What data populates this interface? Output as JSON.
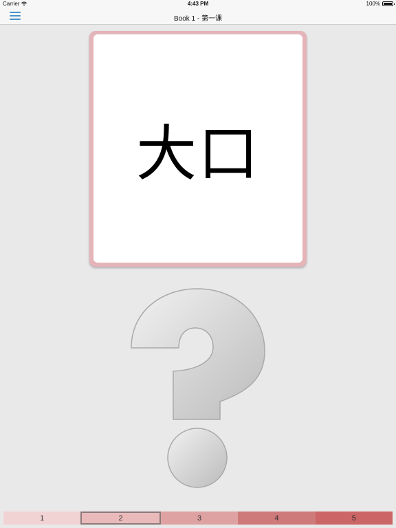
{
  "status_bar": {
    "carrier": "Carrier",
    "time": "4:43 PM",
    "battery": "100%"
  },
  "nav": {
    "title": "Book 1 - 第一课",
    "menu_icon": "hamburger-menu-icon"
  },
  "card": {
    "text": "大口"
  },
  "placeholder_icon": "question-mark-icon",
  "rating": {
    "selected": "2",
    "buttons": [
      {
        "label": "1",
        "color": "#f2d3d3"
      },
      {
        "label": "2",
        "color": "#eababa"
      },
      {
        "label": "3",
        "color": "#dea2a2"
      },
      {
        "label": "4",
        "color": "#cf7a7a"
      },
      {
        "label": "5",
        "color": "#cc6565"
      }
    ]
  },
  "colors": {
    "accent": "#4a90c8",
    "card_border": "#e4b4b8",
    "background": "#e9e9e9"
  }
}
